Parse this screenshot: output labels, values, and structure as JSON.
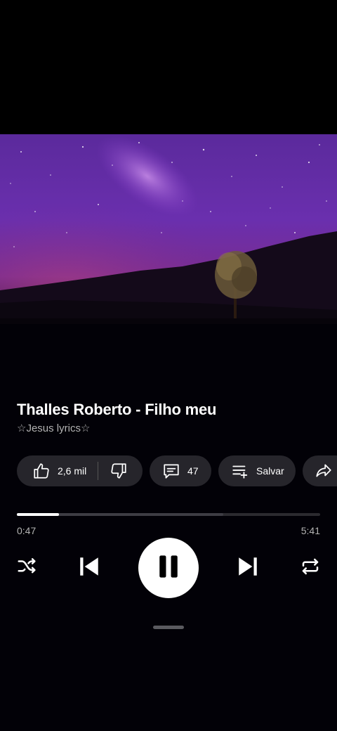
{
  "player": {
    "title": "Thalles Roberto - Filho meu",
    "channel": "☆Jesus lyrics☆",
    "artwork_icon": "starry-sky-artwork"
  },
  "actions": {
    "likes_count": "2,6 mil",
    "comments_count": "47",
    "save_label": "Salvar"
  },
  "playback": {
    "elapsed": "0:47",
    "duration": "5:41",
    "progress_fraction": 0.138,
    "buffered_fraction": 0.68,
    "state": "playing"
  },
  "icons": {
    "like": "thumbs-up-icon",
    "dislike": "thumbs-down-icon",
    "comments": "comment-icon",
    "save": "playlist-add-icon",
    "share": "share-icon",
    "shuffle": "shuffle-icon",
    "previous": "skip-previous-icon",
    "pause": "pause-icon",
    "next": "skip-next-icon",
    "repeat": "repeat-icon"
  },
  "colors": {
    "background": "#000000",
    "chip": "#26252b",
    "accent": "#ffffff",
    "muted_text": "#b3b3b3"
  }
}
